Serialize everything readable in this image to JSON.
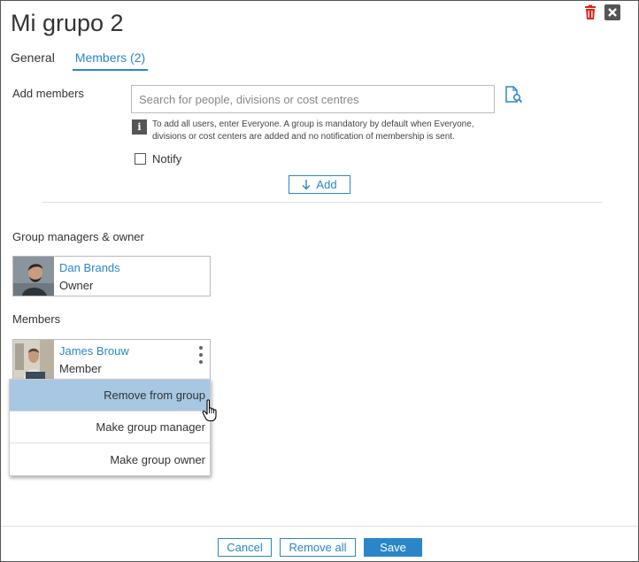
{
  "dialog": {
    "title": "Mi grupo 2"
  },
  "tabs": [
    {
      "label": "General"
    },
    {
      "label": "Members (2)",
      "active": true
    }
  ],
  "add_members": {
    "label": "Add members",
    "search_placeholder": "Search for people, divisions or cost centres",
    "search_value": "",
    "info_text": "To add all users, enter Everyone. A group is mandatory by default when Everyone, divisions or cost centers are added and no notification of membership is sent.",
    "notify_label": "Notify",
    "notify_checked": false,
    "add_button": "Add"
  },
  "managers": {
    "heading": "Group managers & owner",
    "people": [
      {
        "name": "Dan Brands",
        "role": "Owner"
      }
    ]
  },
  "members": {
    "heading": "Members",
    "people": [
      {
        "name": "James Brouw",
        "role": "Member"
      }
    ]
  },
  "context_menu": {
    "items": [
      {
        "label": "Remove from group",
        "highlighted": true
      },
      {
        "label": "Make group manager"
      },
      {
        "label": "Make group owner"
      }
    ]
  },
  "footer": {
    "cancel": "Cancel",
    "remove_all": "Remove all",
    "save": "Save"
  },
  "colors": {
    "accent": "#2a86c9",
    "delete_icon": "#d9261c",
    "menu_highlight": "#a7c7e2"
  },
  "icons": [
    "trash-icon",
    "close-icon",
    "document-search-icon",
    "info-icon",
    "down-arrow-icon",
    "kebab-menu-icon",
    "hand-cursor-icon"
  ]
}
